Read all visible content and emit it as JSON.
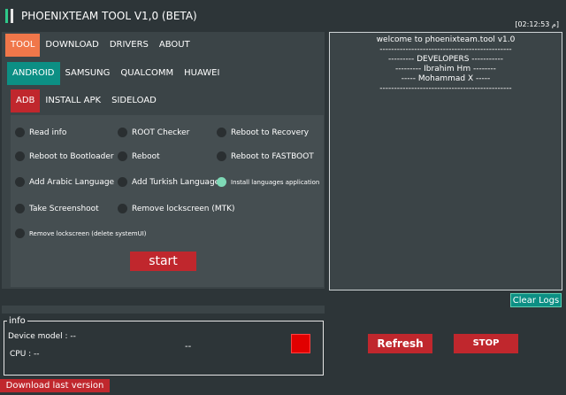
{
  "window": {
    "title": "PHOENIXTEAM TOOL V1,0 (BETA)",
    "clock": "[02:12:53 م]"
  },
  "main_tabs": [
    "TOOL",
    "DOWNLOAD",
    "DRIVERS",
    "ABOUT"
  ],
  "brand_tabs": [
    "ANDROID",
    "SAMSUNG",
    "QUALCOMM",
    "HUAWEI"
  ],
  "mode_tabs": [
    "ADB",
    "INSTALL APK",
    "SIDELOAD"
  ],
  "options": {
    "read_info": "Read info",
    "root_checker": "ROOT Checker",
    "reboot_recovery": "Reboot to Recovery",
    "reboot_bootloader": "Reboot to Bootloader",
    "reboot": "Reboot",
    "reboot_fastboot": "Reboot to FASTBOOT",
    "add_arabic": "Add  Arabic Language",
    "add_turkish": "Add  Turkish Language",
    "install_languages": "Install languages application",
    "take_screenshot": "Take Screenshoot",
    "remove_lock_mtk": "Remove lockscreen (MTK)",
    "remove_lock_delete": "Remove lockscreen (delete systemUI)"
  },
  "selected_option": "install_languages",
  "start_label": "start",
  "log": [
    "welcome to phoenixteam.tool v1.0",
    "----------------------------------------------",
    "--------- DEVELOPERS -----------",
    "--------- Ibrahim Hm --------",
    "----- Mohammad X -----",
    "----------------------------------------------"
  ],
  "clear_logs_label": "Clear Logs",
  "info": {
    "legend": "info",
    "device_model": "Device model : --",
    "cpu": "CPU :   --",
    "status": "--"
  },
  "refresh_label": "Refresh",
  "stop_label": "STOP",
  "download_label": "Download last version",
  "colors": {
    "accent_orange": "#f0774a",
    "accent_teal": "#0c8f84",
    "accent_red": "#c0272d",
    "background": "#2d3538"
  }
}
